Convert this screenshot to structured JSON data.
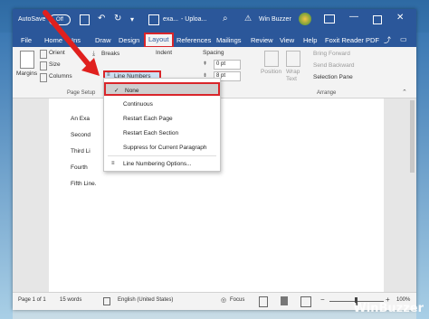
{
  "titlebar": {
    "autosave": "AutoSave",
    "autosave_state": "Off",
    "doc_name": "exa...",
    "upload": "- Uploa...",
    "user": "Win Buzzer"
  },
  "menu": {
    "file": "File",
    "home": "Home",
    "insert": "Ins",
    "draw": "Draw",
    "design": "Design",
    "layout": "Layout",
    "references": "References",
    "mailings": "Mailings",
    "review": "Review",
    "view": "View",
    "help": "Help",
    "foxit": "Foxit Reader PDF"
  },
  "ribbon": {
    "margins": "Margins",
    "orientation": "Orient",
    "size": "Size",
    "columns": "Columns",
    "breaks": "Breaks",
    "line_numbers": "Line Numbers",
    "indent": "Indent",
    "spacing": "Spacing",
    "spacing_before": "0 pt",
    "spacing_after": "8 pt",
    "position": "Position",
    "wrap_text": "Wrap Text",
    "bring_forward": "Bring Forward",
    "send_backward": "Send Backward",
    "selection_pane": "Selection Pane",
    "page_setup": "Page Setup",
    "paragraph": "ph",
    "arrange": "Arrange"
  },
  "dropdown": {
    "items": [
      {
        "label": "None",
        "checked": true
      },
      {
        "label": "Continuous"
      },
      {
        "label": "Restart Each Page"
      },
      {
        "label": "Restart Each Section"
      },
      {
        "label": "Suppress for Current Paragraph"
      },
      {
        "label": "Line Numbering Options..."
      }
    ]
  },
  "document": {
    "lines": [
      "An Exa",
      "Second",
      "Third Li",
      "Fourth",
      "Fifth Line."
    ]
  },
  "status": {
    "page": "Page 1 of 1",
    "words": "15 words",
    "language": "English (United States)",
    "focus": "Focus",
    "zoom": "100%"
  },
  "brand": "WinBuzzer",
  "colors": {
    "word_blue": "#2b579a",
    "highlight_red": "#d9252a"
  }
}
